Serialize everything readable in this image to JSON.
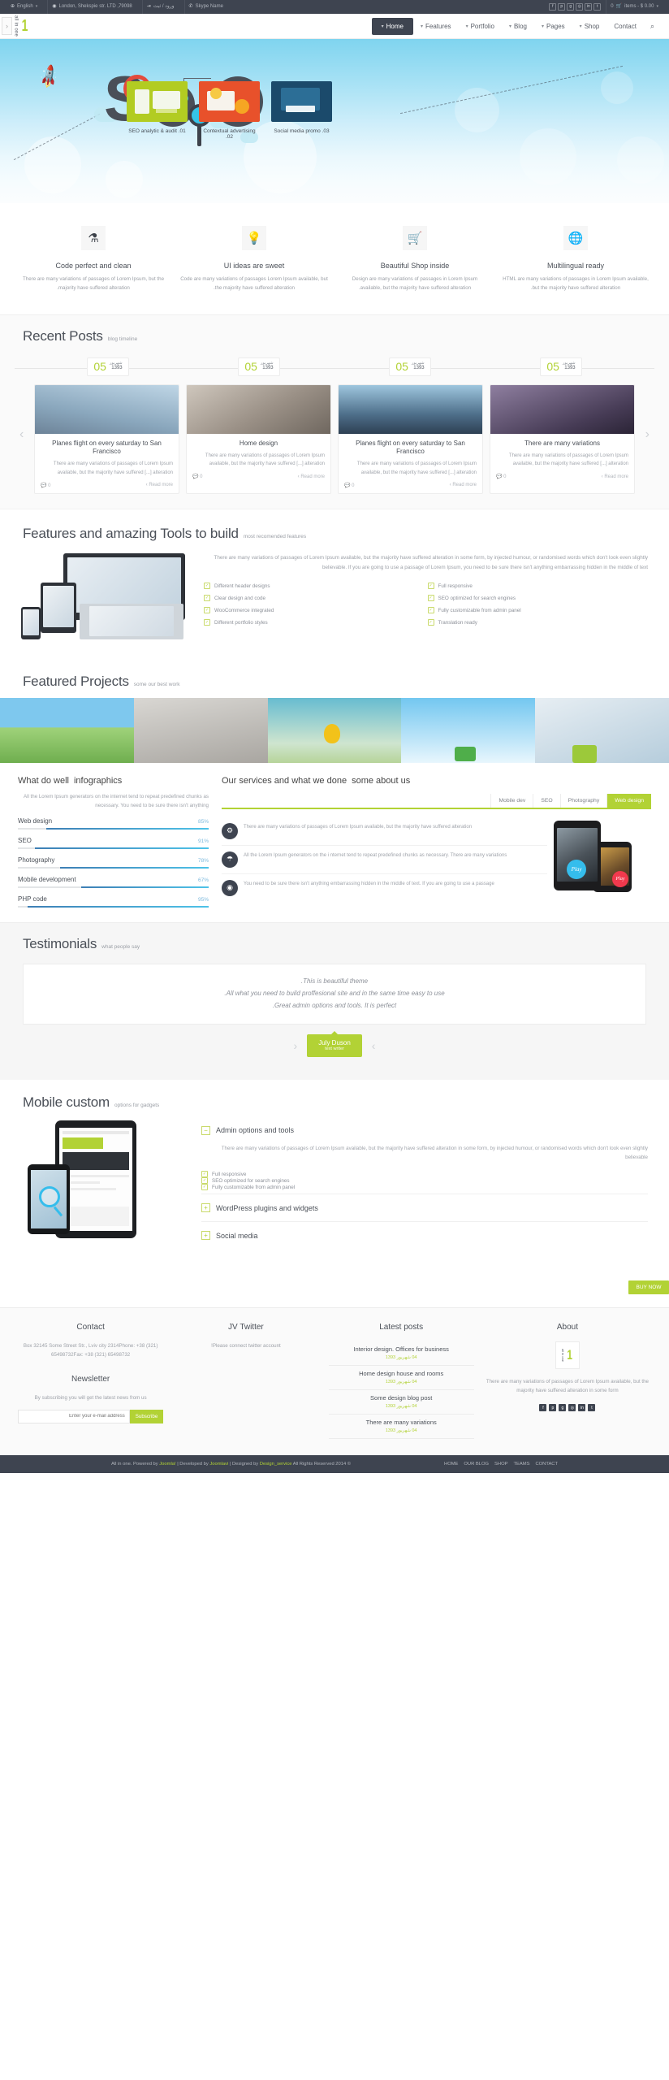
{
  "topbar": {
    "cart": "items - $ 0.00",
    "cart_count": "0",
    "cart_icon": "cart-icon",
    "socials": [
      "twitter",
      "linkedin",
      "instagram",
      "google-plus",
      "pinterest",
      "facebook"
    ],
    "skype": "Skype Name",
    "skype_icon": "skype-icon",
    "login": "ورود / ثبت",
    "login_icon": "login-icon",
    "address": "London, Shekspie str. LTD ,79098",
    "address_icon": "location-pin-icon",
    "language": "English",
    "language_icon": "globe-icon"
  },
  "nav": {
    "search_icon": "search-icon",
    "logo_arrow": "1",
    "logo_text": "all in one",
    "side_toggle": "‹",
    "items": [
      {
        "label": "Contact",
        "has_caret": false,
        "active": false
      },
      {
        "label": "Shop",
        "has_caret": true,
        "active": false
      },
      {
        "label": "Pages",
        "has_caret": true,
        "active": false
      },
      {
        "label": "Blog",
        "has_caret": true,
        "active": false
      },
      {
        "label": "Portfolio",
        "has_caret": true,
        "active": false
      },
      {
        "label": "Features",
        "has_caret": true,
        "active": false
      },
      {
        "label": "Home",
        "has_caret": true,
        "active": true
      }
    ]
  },
  "hero": {
    "word": "SEO",
    "promos": [
      {
        "label": "Social media promo .03",
        "color": "#1b4a6b"
      },
      {
        "label": "Contextual advertising .02",
        "color": "#e8512b"
      },
      {
        "label": "SEO analytic & audit .01",
        "color": "#b2cc22"
      }
    ]
  },
  "features4": [
    {
      "icon": "globe-icon",
      "glyph": "⊕",
      "title": "Multilingual ready",
      "desc": "HTML are many variations of passages in Lorem Ipsum available, but the majority have suffered alteration."
    },
    {
      "icon": "shopping-cart-icon",
      "glyph": "⑀",
      "title": "Beautiful Shop inside",
      "desc": "Design are many variations of passages in Lorem Ipsum available, but the majority have suffered alteration."
    },
    {
      "icon": "lightbulb-icon",
      "glyph": "⚬",
      "title": "UI ideas are sweet",
      "desc": "Code are many variations of passages Lorem Ipsum available, but the majority have suffered alteration."
    },
    {
      "icon": "flask-icon",
      "glyph": "⚗",
      "title": "Code perfect and clean",
      "desc": "There are many variations of passages of Lorem Ipsum, but the majority have suffered alteration."
    }
  ],
  "recent": {
    "sub": "blog timeline",
    "title": "Recent Posts",
    "prev_icon": "chevron-left-icon",
    "next_icon": "chevron-right-icon",
    "dates": [
      {
        "day": "05",
        "month": "شهریور",
        "year": "1393"
      },
      {
        "day": "05",
        "month": "شهریور",
        "year": "1393"
      },
      {
        "day": "05",
        "month": "شهریور",
        "year": "1393"
      },
      {
        "day": "05",
        "month": "شهریور",
        "year": "1393"
      }
    ],
    "posts": [
      {
        "title": "There are many variations",
        "text": "There are many variations of passages of Lorem Ipsum available, but the majority have suffered [...] alteration",
        "comments": "0",
        "more": "Read more ›",
        "thumb": "#6b5f74"
      },
      {
        "title": "Planes flight on every saturday to San Francisco",
        "text": "There are many variations of passages of Lorem Ipsum available, but the majority have suffered [...] alteration",
        "comments": "0",
        "more": "Read more ›",
        "thumb": "#5b7fa0"
      },
      {
        "title": "Home design",
        "text": "There are many variations of passages of Lorem Ipsum available, but the majority have suffered [...] alteration",
        "comments": "0",
        "more": "Read more ›",
        "thumb": "#9b9288"
      },
      {
        "title": "Planes flight on every saturday to San Francisco",
        "text": "There are many variations of passages of Lorem Ipsum available, but the majority have suffered [...] alteration",
        "comments": "0",
        "more": "Read more ›",
        "thumb": "#8fa6bb"
      }
    ]
  },
  "tools": {
    "sub": "most recomended features",
    "title": "Features and amazing Tools to build",
    "paragraph": "There are many variations of passages of Lorem Ipsum available, but the majority have suffered alteration in some form, by injected humour, or randomised words which don't look even slightly believable. If you are going to use a passage of Lorem Ipsum, you need to be sure there isn't anything embarrassing hidden in the middle of text",
    "col_right": [
      "Different header designs",
      "Clear design and code",
      "WooCommerce integrated",
      "Different portfolio styles"
    ],
    "col_left": [
      "Full responsive",
      "SEO optimized for search engines",
      "Fully customizable from admin panel",
      "Translation ready"
    ]
  },
  "projects": {
    "sub": "some our best work",
    "title": "Featured Projects",
    "items": [
      {
        "color1": "#cfe0ea",
        "color2": "#a9c8db"
      },
      {
        "color1": "#7ec8ef",
        "color2": "#d6eefb"
      },
      {
        "color1": "#5fb6c9",
        "color2": "#cfe3c9"
      },
      {
        "color1": "#b9b7b2",
        "color2": "#d8d6d2"
      },
      {
        "color1": "#78c5e8",
        "color2": "#9fd27a"
      }
    ]
  },
  "infographics": {
    "sub": "infographics",
    "title": "What do well",
    "desc": "All the Lorem Ipsum generators on the internet tend to repeat predefined chunks as necessary. You need to be sure there isn't anything"
  },
  "chart_data": {
    "type": "bar",
    "title": "What do well",
    "categories": [
      "Web design",
      "SEO",
      "Photography",
      "Mobile development",
      "PHP code"
    ],
    "values": [
      85,
      91,
      78,
      67,
      95
    ],
    "value_labels": [
      "85%",
      "91%",
      "78%",
      "67%",
      "95%"
    ],
    "xlabel": "",
    "ylabel": "",
    "ylim": [
      0,
      100
    ],
    "orientation": "horizontal",
    "grid": false,
    "legend": false
  },
  "services": {
    "sub": "some about us",
    "title": "Our services and what we done",
    "tabs": [
      {
        "label": "Web design",
        "active": true
      },
      {
        "label": "Photography",
        "active": false
      },
      {
        "label": "SEO",
        "active": false
      },
      {
        "label": "Mobile dev",
        "active": false
      }
    ],
    "items": [
      {
        "icon": "gears-icon",
        "glyph": "⚙",
        "text": "There are many variations of passages of Lorem Ipsum available, but the majority have suffered alteration"
      },
      {
        "icon": "umbrella-icon",
        "glyph": "☂",
        "text": "All the Lorem Ipsum generators on the i nternet tend to repeat predefined chunks as necessary. There are many variations"
      },
      {
        "icon": "camera-icon",
        "glyph": "◉",
        "text": "You need to be sure there isn't anything embarrassing hidden in the middle of text. If you are going to use a passage"
      }
    ],
    "play_label_front": "Play",
    "play_label_back": "Play"
  },
  "testimonials": {
    "sub": "what people say",
    "title": "Testimonials",
    "quote_line1": "This is beautiful theme.",
    "quote_line2": "All what you need to build proffesional site and in the same time easy to use.",
    "quote_line3": "Great admin options and tools. It is perfect.",
    "author_name": "July Duson",
    "author_role": "text writer",
    "prev_icon": "chevron-left-icon",
    "next_icon": "chevron-right-icon"
  },
  "mobile": {
    "sub": "options for gadgets",
    "title": "Mobile custom",
    "accordion_open": "Admin options and tools",
    "accordion_open_sign": "−",
    "open_text": "There are many variations of passages of Lorem Ipsum available, but the majority have suffered alteration in some form, by injected humour, or randomised words which don't look even slightly believable",
    "checks": [
      "Full responsive",
      "SEO optimized for search engines",
      "Fully customizable from admin panel"
    ],
    "closed_items": [
      {
        "label": "WordPress plugins and widgets",
        "sign": "+"
      },
      {
        "label": "Social media",
        "sign": "+"
      }
    ],
    "buy_label": "BUY NOW"
  },
  "footer": {
    "contact": {
      "title": "Contact",
      "text": "Box 32145 Some Street Str., Lviv city 2314Phone: +38 (321) 65498732Fax: +38 (321) 65498732"
    },
    "newsletter": {
      "title": "Newsletter",
      "text": "By subscribing you will get the latest news from us",
      "button": "Subscribe",
      "placeholder": "Enter your e-mail address",
      "value": ""
    },
    "twitter": {
      "title": "JV Twitter",
      "text": "Please connect twitter account!"
    },
    "latest": {
      "title": "Latest posts",
      "posts": [
        {
          "title": "Interior design. Offices for business",
          "date": "04 شهریور 1393"
        },
        {
          "title": "Home design house and rooms",
          "date": "04 شهریور 1393"
        },
        {
          "title": "Some design blog post",
          "date": "04 شهریور 1393"
        },
        {
          "title": "There are many variations",
          "date": "04 شهریور 1393"
        }
      ]
    },
    "about": {
      "title": "About",
      "logo_arrow": "1",
      "logo_text": "all in one",
      "text": "There are many variations of passages of Lorem Ipsum available, but the majority have suffered alteration in some form",
      "socials": [
        "twitter",
        "linkedin",
        "instagram",
        "google-plus",
        "pinterest",
        "facebook"
      ]
    }
  },
  "bottombar": {
    "links": [
      "CONTACT",
      "TEAMS",
      "SHOP",
      "OUR BLOG",
      "HOME"
    ],
    "credit_1": "All in one. Powered by ",
    "credit_link_1": "Joomla!",
    "credit_2": " | Developed by ",
    "credit_link_2": "Joomlavi",
    "credit_3": " | Designed by ",
    "credit_link_3": "Design_service",
    "credit_4": " All Rights Reserved 2014 ©"
  }
}
